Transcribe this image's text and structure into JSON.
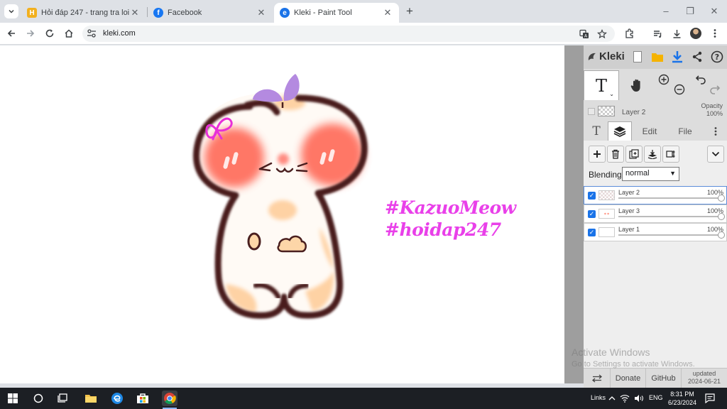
{
  "browser": {
    "tabs": [
      {
        "title": "Hỏi đáp 247 - trang tra loi",
        "favicon_letter": "H",
        "favicon_color": "#f2b01e"
      },
      {
        "title": "Facebook",
        "favicon_letter": "f",
        "favicon_color": "#1877f2"
      },
      {
        "title": "Kleki - Paint Tool",
        "favicon_letter": "e",
        "favicon_color": "#1a73e8"
      }
    ],
    "url": "kleki.com"
  },
  "canvas": {
    "hashtag1": "#KazuoMeow",
    "hashtag2": "#hoidap247",
    "hashtag_color": "#e940e9"
  },
  "kleki": {
    "logo": "Kleki",
    "current_tool_glyph": "T",
    "current_layer": {
      "name": "Layer 2",
      "opacity_label": "Opacity",
      "opacity_value": "100%"
    },
    "tabs": {
      "text_glyph": "T",
      "edit": "Edit",
      "file": "File"
    },
    "blending_label": "Blending",
    "blending_value": "normal",
    "layers": [
      {
        "name": "Layer 2",
        "opacity": "100%",
        "selected": true
      },
      {
        "name": "Layer 3",
        "opacity": "100%",
        "selected": false
      },
      {
        "name": "Layer 1",
        "opacity": "100%",
        "selected": false
      }
    ],
    "footer": {
      "donate": "Donate",
      "github": "GitHub",
      "updated_label": "updated",
      "updated_date": "2024-06-21"
    }
  },
  "watermark": {
    "line1": "Activate Windows",
    "line2": "Go to Settings to activate Windows."
  },
  "taskbar": {
    "links": "Links",
    "lang": "ENG",
    "time": "8:31 PM",
    "date": "6/23/2024"
  }
}
